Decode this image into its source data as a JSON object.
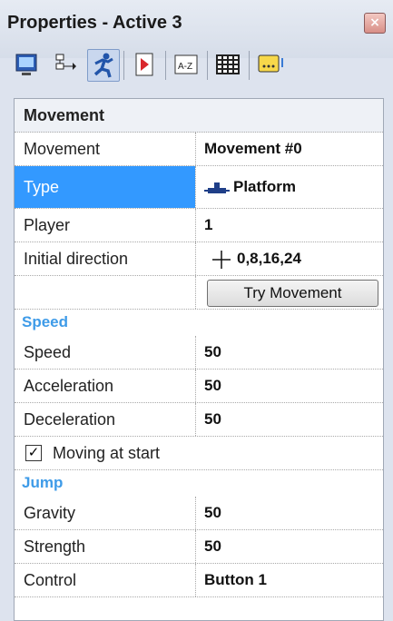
{
  "window": {
    "title": "Properties - Active 3",
    "close_glyph": "×"
  },
  "toolbar": {
    "icons": [
      "display-icon",
      "connect-icon",
      "movement-icon",
      "events-icon",
      "sort-az-icon",
      "grid-icon",
      "comment-icon"
    ]
  },
  "movement": {
    "header": "Movement",
    "rows": [
      {
        "label": "Movement",
        "value": "Movement #0"
      },
      {
        "label": "Type",
        "value": "Platform"
      },
      {
        "label": "Player",
        "value": "1"
      },
      {
        "label": "Initial direction",
        "value": "0,8,16,24"
      }
    ],
    "try_button": "Try Movement"
  },
  "speed": {
    "header": "Speed",
    "rows": [
      {
        "label": "Speed",
        "value": "50"
      },
      {
        "label": "Acceleration",
        "value": "50"
      },
      {
        "label": "Deceleration",
        "value": "50"
      }
    ]
  },
  "moving_at_start": {
    "label": "Moving at start",
    "checked": true
  },
  "jump": {
    "header": "Jump",
    "rows": [
      {
        "label": "Gravity",
        "value": "50"
      },
      {
        "label": "Strength",
        "value": "50"
      },
      {
        "label": "Control",
        "value": "Button 1"
      }
    ]
  }
}
